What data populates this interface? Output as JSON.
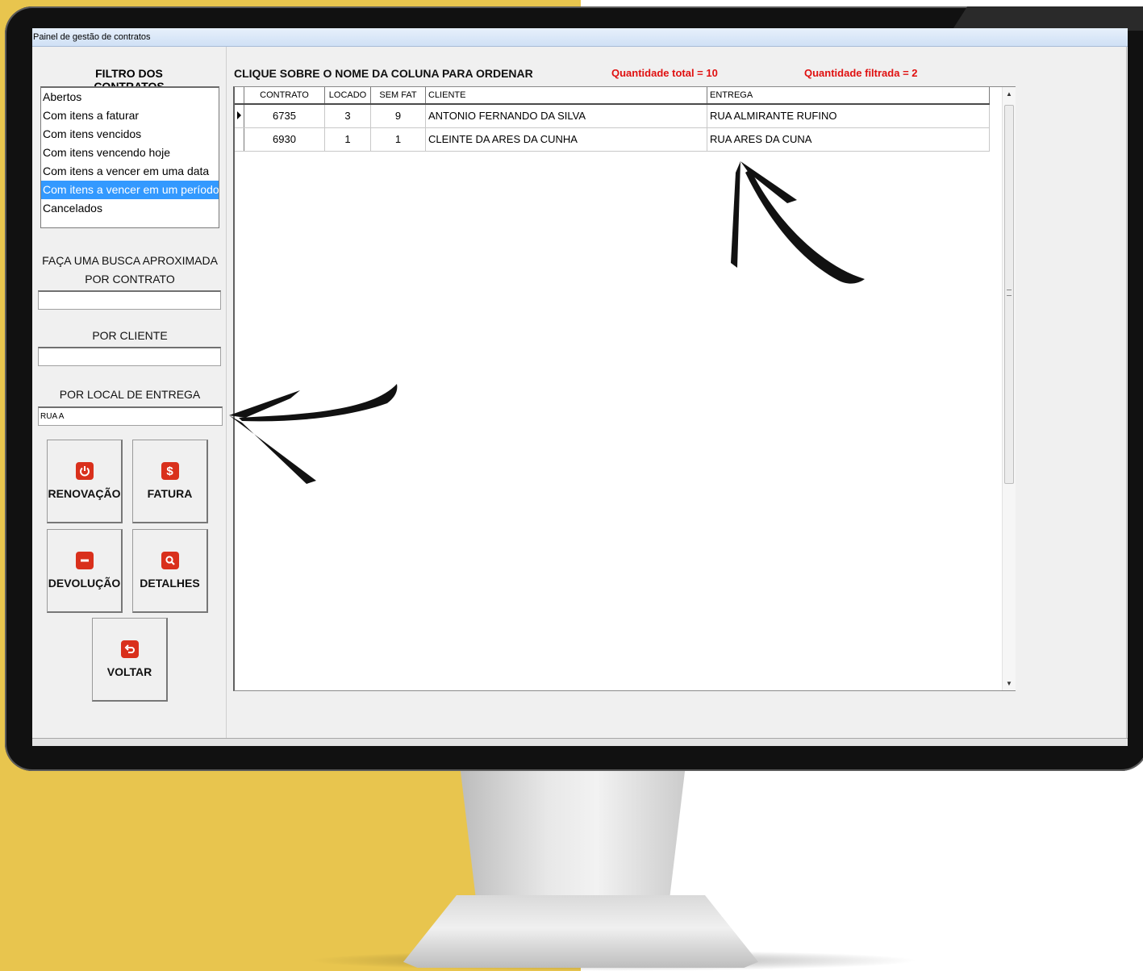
{
  "window": {
    "title": "Painel de gestão de contratos"
  },
  "filters": {
    "title": "FILTRO DOS CONTRATOS",
    "items": [
      {
        "label": "Abertos",
        "selected": false
      },
      {
        "label": "Com itens a faturar",
        "selected": false
      },
      {
        "label": "Com itens vencidos",
        "selected": false
      },
      {
        "label": "Com itens vencendo hoje",
        "selected": false
      },
      {
        "label": "Com itens a vencer em uma data",
        "selected": false
      },
      {
        "label": "Com itens a vencer em um período",
        "selected": true
      },
      {
        "label": "Cancelados",
        "selected": false
      }
    ]
  },
  "search": {
    "heading_line1": "FAÇA UMA BUSCA APROXIMADA",
    "by_contract_label": "POR CONTRATO",
    "by_contract_value": "",
    "by_client_label": "POR CLIENTE",
    "by_client_value": "",
    "by_delivery_label": "POR LOCAL DE ENTREGA",
    "by_delivery_value": "RUA A"
  },
  "actions": {
    "renew_label": "RENOVAÇÃO",
    "invoice_label": "FATURA",
    "return_label": "DEVOLUÇÃO",
    "details_label": "DETALHES",
    "back_label": "VOLTAR",
    "invoice_glyph": "$"
  },
  "grid": {
    "instruction": "CLIQUE SOBRE O NOME DA COLUNA PARA ORDENAR",
    "total_label": "Quantidade total = 10",
    "filtered_label": "Quantidade filtrada = 2",
    "columns": [
      "CONTRATO",
      "LOCADO",
      "SEM FAT",
      "CLIENTE",
      "ENTREGA"
    ],
    "rows": [
      {
        "contrato": "6735",
        "locado": "3",
        "sem_fat": "9",
        "cliente": "ANTONIO FERNANDO DA SILVA",
        "entrega": "RUA ALMIRANTE RUFINO",
        "current": true
      },
      {
        "contrato": "6930",
        "locado": "1",
        "sem_fat": "1",
        "cliente": "CLEINTE DA ARES DA CUNHA",
        "entrega": "RUA ARES DA CUNA",
        "current": false
      }
    ]
  },
  "colors": {
    "accent_selected": "#3399ff",
    "button_icon": "#d9301c",
    "count_text": "#e01010",
    "backdrop": "#e8c54e"
  }
}
